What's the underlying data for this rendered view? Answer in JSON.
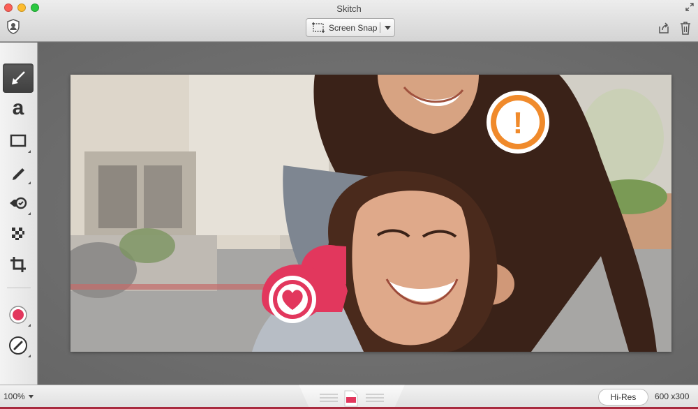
{
  "window": {
    "title": "Skitch"
  },
  "toolbar": {
    "snap_label": "Screen Snap",
    "icons": {
      "account": "account-icon",
      "snap": "screen-snap-icon",
      "dropdown": "chevron-down-icon",
      "share": "share-icon",
      "trash": "trash-icon"
    }
  },
  "tools": [
    {
      "name": "arrow-tool",
      "icon": "arrow-icon",
      "active": true
    },
    {
      "name": "text-tool",
      "label": "a",
      "active": false
    },
    {
      "name": "shape-tool",
      "icon": "rectangle-icon",
      "active": false
    },
    {
      "name": "pen-tool",
      "icon": "pencil-icon",
      "active": false
    },
    {
      "name": "stamp-tool",
      "icon": "stamp-icon",
      "active": false
    },
    {
      "name": "pixelate-tool",
      "icon": "pixelate-icon",
      "active": false
    },
    {
      "name": "crop-tool",
      "icon": "crop-icon",
      "active": false
    }
  ],
  "colors": {
    "accent": "#e2375d",
    "stamp_orange": "#f08a2b",
    "active_tool_bg": "#4a4a4a",
    "status_accent": "#a82a3e"
  },
  "annotations": {
    "exclamation": "!",
    "heart_stamp": "heart-icon"
  },
  "status": {
    "zoom": "100%",
    "hires_label": "Hi-Res",
    "dimensions": "600 x300"
  }
}
